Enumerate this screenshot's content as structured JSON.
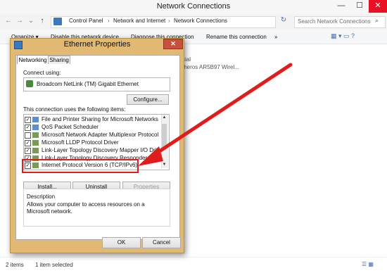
{
  "window": {
    "title": "Network Connections",
    "controls": {
      "minimize": "—",
      "maximize": "☐",
      "close": "✕"
    }
  },
  "address_bar": {
    "crumbs": [
      "Control Panel",
      "Network and Internet",
      "Network Connections"
    ],
    "separator": "›",
    "search_placeholder": "Search Network Connections"
  },
  "toolbar": {
    "items": [
      "Organize ▾",
      "Disable this network device",
      "Diagnose this connection",
      "Rename this connection",
      "»"
    ]
  },
  "background_items": {
    "line1": "cial",
    "line2": "theros AR5B97 Wirel..."
  },
  "status_bar": {
    "count": "2 items",
    "selected": "1 item selected"
  },
  "dialog": {
    "title": "Ethernet Properties",
    "tabs": [
      "Networking",
      "Sharing"
    ],
    "connect_using_label": "Connect using:",
    "adapter_name": "Broadcom NetLink (TM) Gigabit Ethernet",
    "configure_button": "Configure...",
    "items_label": "This connection uses the following items:",
    "items": [
      {
        "label": "File and Printer Sharing for Microsoft Networks",
        "checked": true
      },
      {
        "label": "QoS Packet Scheduler",
        "checked": true
      },
      {
        "label": "Microsoft Network Adapter Multiplexor Protocol",
        "checked": false
      },
      {
        "label": "Microsoft LLDP Protocol Driver",
        "checked": true
      },
      {
        "label": "Link-Layer Topology Discovery Mapper I/O Driver",
        "checked": true
      },
      {
        "label": "Link-Layer Topology Discovery Responder",
        "checked": true
      },
      {
        "label": "Internet Protocol Version 6 (TCP/IPv6)",
        "checked": true
      }
    ],
    "install_button": "Install...",
    "uninstall_button": "Uninstall",
    "properties_button": "Properties",
    "description_title": "Description",
    "description_text": "Allows your computer to access resources on a Microsoft network.",
    "ok_button": "OK",
    "cancel_button": "Cancel"
  },
  "colors": {
    "annotation_red": "#e01d1d",
    "dialog_frame": "#e1b973",
    "close_red": "#e81123"
  }
}
